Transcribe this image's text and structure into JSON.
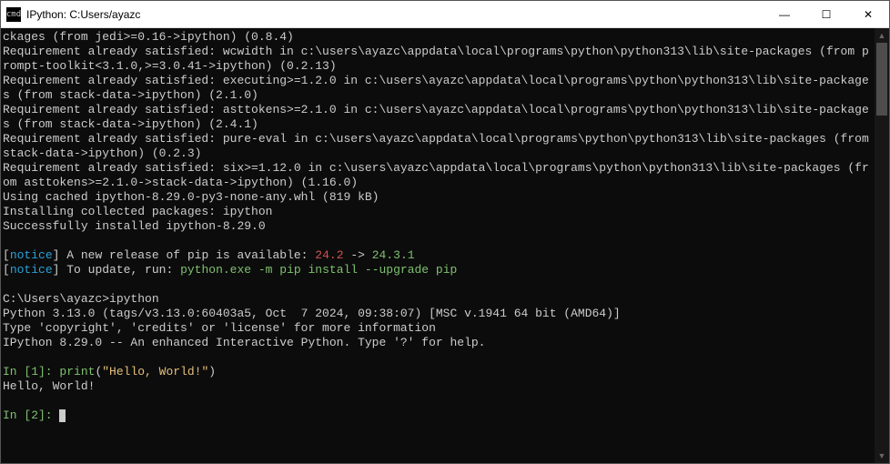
{
  "window": {
    "title": "IPython: C:Users/ayazc",
    "icon_label": "cmd"
  },
  "controls": {
    "minimize": "—",
    "maximize": "☐",
    "close": "✕"
  },
  "term": {
    "l01": "ckages (from jedi>=0.16->ipython) (0.8.4)",
    "l02": "Requirement already satisfied: wcwidth in c:\\users\\ayazc\\appdata\\local\\programs\\python\\python313\\lib\\site-packages (from prompt-toolkit<3.1.0,>=3.0.41->ipython) (0.2.13)",
    "l03": "Requirement already satisfied: executing>=1.2.0 in c:\\users\\ayazc\\appdata\\local\\programs\\python\\python313\\lib\\site-packages (from stack-data->ipython) (2.1.0)",
    "l04": "Requirement already satisfied: asttokens>=2.1.0 in c:\\users\\ayazc\\appdata\\local\\programs\\python\\python313\\lib\\site-packages (from stack-data->ipython) (2.4.1)",
    "l05": "Requirement already satisfied: pure-eval in c:\\users\\ayazc\\appdata\\local\\programs\\python\\python313\\lib\\site-packages (from stack-data->ipython) (0.2.3)",
    "l06": "Requirement already satisfied: six>=1.12.0 in c:\\users\\ayazc\\appdata\\local\\programs\\python\\python313\\lib\\site-packages (from asttokens>=2.1.0->stack-data->ipython) (1.16.0)",
    "l07": "Using cached ipython-8.29.0-py3-none-any.whl (819 kB)",
    "l08": "Installing collected packages: ipython",
    "l09": "Successfully installed ipython-8.29.0",
    "blank1": "",
    "notice1_open": "[",
    "notice1_word": "notice",
    "notice1_close": "]",
    "notice1_text": " A new release of pip is available: ",
    "notice1_old": "24.2",
    "notice1_arrow": " -> ",
    "notice1_new": "24.3.1",
    "notice2_open": "[",
    "notice2_word": "notice",
    "notice2_close": "]",
    "notice2_text": " To update, run: ",
    "notice2_cmd": "python.exe -m pip install --upgrade pip",
    "blank2": "",
    "prompt_cmd": "C:\\Users\\ayazc>ipython",
    "py_ver": "Python 3.13.0 (tags/v3.13.0:60403a5, Oct  7 2024, 09:38:07) [MSC v.1941 64 bit (AMD64)]",
    "py_info": "Type 'copyright', 'credits' or 'license' for more information",
    "ipy_info": "IPython 8.29.0 -- An enhanced Interactive Python. Type '?' for help.",
    "blank3": "",
    "in1_prompt": "In [1]: ",
    "in1_func": "print",
    "in1_paren_open": "(",
    "in1_string": "\"Hello, World!\"",
    "in1_paren_close": ")",
    "out1": "Hello, World!",
    "blank4": "",
    "in2_prompt": "In [2]: "
  }
}
